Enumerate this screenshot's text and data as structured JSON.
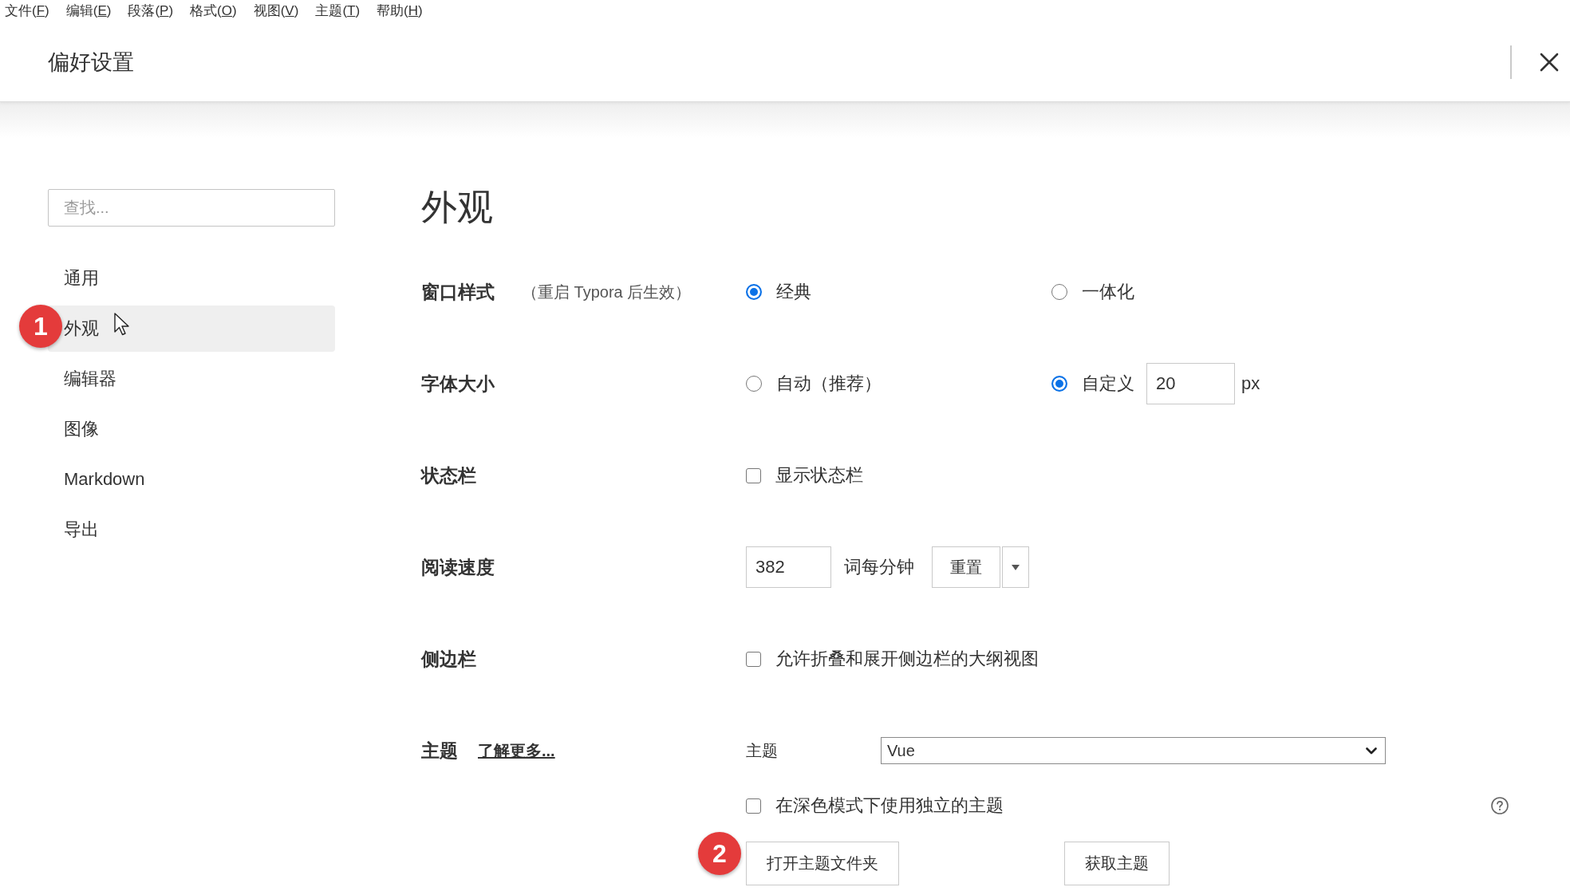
{
  "menu_bar": [
    {
      "label": "文件(F)",
      "key_underlined": true
    },
    {
      "label": "编辑(E)",
      "key_underlined": true
    },
    {
      "label": "段落(P)",
      "key_underlined": true
    },
    {
      "label": "格式(O)",
      "key_underlined": true
    },
    {
      "label": "视图(V)",
      "key_underlined": true
    },
    {
      "label": "主题(T)",
      "key_underlined": true
    },
    {
      "label": "帮助(H)",
      "key_underlined": true
    }
  ],
  "header": {
    "title": "偏好设置"
  },
  "sidebar": {
    "search": {
      "placeholder": "查找..."
    },
    "items": [
      {
        "label": "通用",
        "selected": false,
        "hovered": false
      },
      {
        "label": "外观",
        "selected": true,
        "hovered": true,
        "badge": "1"
      },
      {
        "label": "编辑器",
        "selected": false,
        "hovered": false
      },
      {
        "label": "图像",
        "selected": false,
        "hovered": false
      },
      {
        "label": "Markdown",
        "selected": false,
        "hovered": false
      },
      {
        "label": "导出",
        "selected": false,
        "hovered": false
      }
    ]
  },
  "content": {
    "title": "外观",
    "settings": [
      {
        "kind": "radio",
        "label": "窗口样式",
        "hint": "（重启 Typora 后生效）",
        "options": [
          {
            "label": "经典",
            "selected": true
          },
          {
            "label": "一体化",
            "selected": false
          }
        ]
      },
      {
        "kind": "radio",
        "label": "字体大小",
        "options": [
          {
            "label": "自动（推荐）",
            "selected": false
          },
          {
            "label": "自定义",
            "selected": true,
            "value": "20",
            "unit": "px"
          }
        ]
      },
      {
        "kind": "checkbox",
        "label": "状态栏",
        "option": {
          "label": "显示状态栏",
          "checked": false
        }
      },
      {
        "kind": "number",
        "label": "阅读速度",
        "value": "382",
        "unit": "词每分钟",
        "button": "重置"
      },
      {
        "kind": "checkbox",
        "label": "侧边栏",
        "option": {
          "label": "允许折叠和展开侧边栏的大纲视图",
          "checked": false
        }
      },
      {
        "kind": "theme",
        "label": "主题",
        "link": "了解更多...",
        "select": {
          "label": "主题",
          "value": "Vue"
        },
        "option": {
          "label": "在深色模式下使用独立的主题",
          "checked": false
        },
        "buttons": [
          {
            "label": "打开主题文件夹",
            "badge": "2"
          },
          {
            "label": "获取主题"
          }
        ]
      }
    ]
  }
}
